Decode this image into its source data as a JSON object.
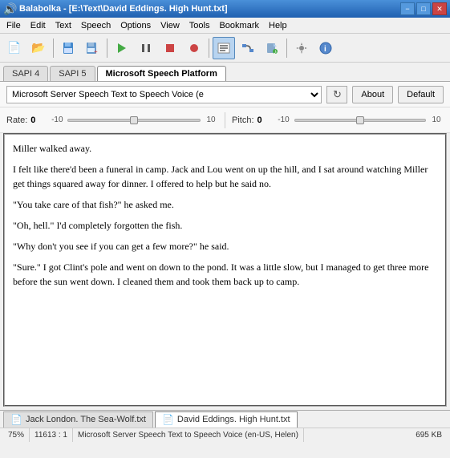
{
  "titlebar": {
    "icon": "🔊",
    "text": "Balabolka - [E:\\Text\\David Eddings. High Hunt.txt]",
    "minimize": "−",
    "maximize": "□",
    "close": "✕"
  },
  "menubar": {
    "items": [
      "File",
      "Edit",
      "Text",
      "Speech",
      "Options",
      "View",
      "Tools",
      "Bookmark",
      "Help"
    ]
  },
  "tabs": {
    "items": [
      "SAPI 4",
      "SAPI 5",
      "Microsoft Speech Platform"
    ],
    "active": 2
  },
  "voice": {
    "selected": "Microsoft Server Speech Text to Speech Voice (e",
    "about_label": "About",
    "default_label": "Default"
  },
  "sliders": {
    "rate_label": "Rate:",
    "rate_value": "0",
    "rate_min": "-10",
    "rate_max": "10",
    "pitch_label": "Pitch:",
    "pitch_value": "0",
    "pitch_min": "-10",
    "pitch_max": "10"
  },
  "content": {
    "paragraphs": [
      "Miller walked away.",
      "I felt like there'd been a funeral in camp. Jack and Lou went on up the hill, and I sat around watching Miller get things squared away for dinner. I offered to help but he said no.",
      "\"You take care of that fish?\" he asked me.",
      "\"Oh, hell.\" I'd completely forgotten the fish.",
      "\"Why don't you see if you can get a few more?\" he said.",
      "\"Sure.\" I got Clint's pole and went on down to the pond. It was a little slow, but I managed to get three more before the sun went down. I cleaned them and took them back up to camp."
    ]
  },
  "bottom_tabs": [
    {
      "icon": "📄",
      "label": "Jack London. The Sea-Wolf.txt",
      "active": false
    },
    {
      "icon": "📄",
      "label": "David Eddings. High Hunt.txt",
      "active": true
    }
  ],
  "statusbar": {
    "zoom": "75%",
    "position": "11613 : 1",
    "voice": "Microsoft Server Speech Text to Speech Voice (en-US, Helen)",
    "size": "695 KB"
  },
  "toolbar": {
    "buttons": [
      {
        "name": "new",
        "icon": "📄"
      },
      {
        "name": "open",
        "icon": "📂"
      },
      {
        "name": "save",
        "icon": "💾"
      },
      {
        "name": "print",
        "icon": "🖨"
      },
      {
        "name": "play",
        "icon": "▶"
      },
      {
        "name": "pause",
        "icon": "⏸"
      },
      {
        "name": "stop",
        "icon": "⏹"
      },
      {
        "name": "record",
        "icon": "⏺"
      },
      {
        "name": "convert",
        "icon": "🔄"
      },
      {
        "name": "file-audio",
        "icon": "🎵"
      },
      {
        "name": "settings",
        "icon": "⚙"
      },
      {
        "name": "text",
        "icon": "📝"
      }
    ]
  }
}
